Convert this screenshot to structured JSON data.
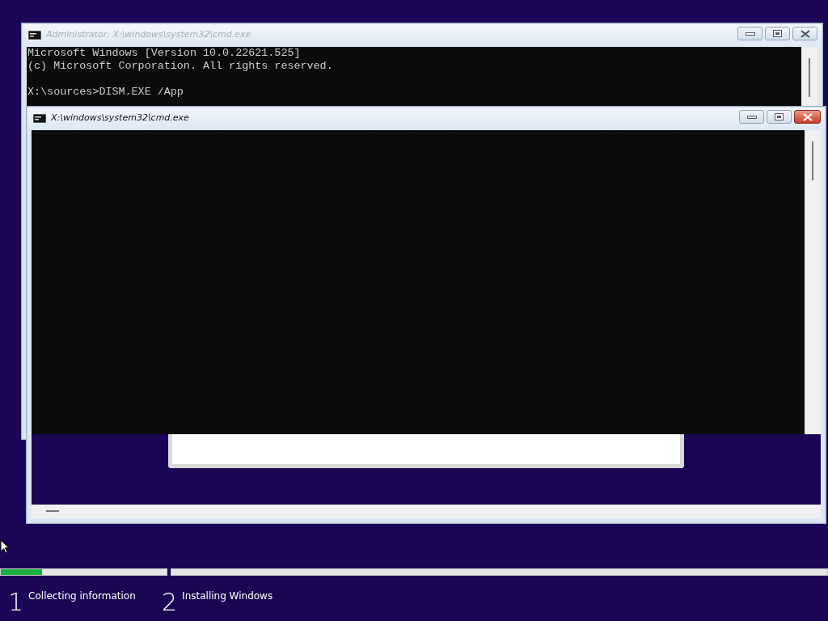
{
  "windows": [
    {
      "title": "Administrator: X:\\windows\\system32\\cmd.exe",
      "active": false,
      "lines": [
        "Microsoft Windows [Version 10.0.22621.525]",
        "(c) Microsoft Corporation. All rights reserved."
      ],
      "prompt": "X:\\sources>DISM.EXE /App"
    },
    {
      "title": "X:\\windows\\system32\\cmd.exe",
      "active": true
    }
  ],
  "steps": [
    {
      "number": "1",
      "label": "Collecting information",
      "level": 0.25
    },
    {
      "number": "2",
      "label": "Installing Windows",
      "level": 0
    }
  ]
}
